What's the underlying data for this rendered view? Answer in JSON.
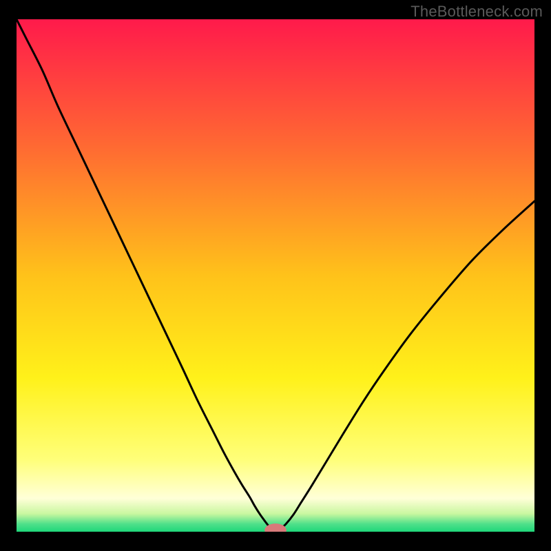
{
  "watermark": "TheBottleneck.com",
  "chart_data": {
    "type": "line",
    "title": "",
    "xlabel": "",
    "ylabel": "",
    "xlim": [
      0,
      100
    ],
    "ylim": [
      0,
      100
    ],
    "gradient_stops": [
      {
        "offset": 0.0,
        "color": "#ff1a4b"
      },
      {
        "offset": 0.25,
        "color": "#ff6a32"
      },
      {
        "offset": 0.5,
        "color": "#ffc21a"
      },
      {
        "offset": 0.7,
        "color": "#fff11a"
      },
      {
        "offset": 0.86,
        "color": "#ffff7a"
      },
      {
        "offset": 0.935,
        "color": "#ffffd8"
      },
      {
        "offset": 0.965,
        "color": "#c9f7a0"
      },
      {
        "offset": 0.985,
        "color": "#4fe08a"
      },
      {
        "offset": 1.0,
        "color": "#1fd77a"
      }
    ],
    "series": [
      {
        "name": "curve",
        "x": [
          0,
          2,
          5,
          8,
          12,
          16,
          20,
          24,
          28,
          32,
          35,
          38,
          40,
          42,
          43.5,
          45,
          46,
          47,
          48,
          48.7,
          49.3,
          49.8,
          50.3,
          51,
          52,
          53.5,
          55,
          57,
          60,
          63,
          67,
          71,
          76,
          82,
          88,
          94,
          100
        ],
        "y": [
          100,
          96,
          90,
          83,
          74.5,
          66,
          57.5,
          49,
          40.5,
          32,
          25.5,
          19.5,
          15.5,
          11.8,
          9.2,
          6.8,
          5.0,
          3.4,
          2.0,
          1.1,
          0.5,
          0.25,
          0.25,
          0.6,
          1.5,
          3.4,
          5.8,
          9.0,
          14.0,
          19.0,
          25.5,
          31.5,
          38.5,
          46.0,
          53.0,
          59.0,
          64.5
        ]
      }
    ],
    "marker": {
      "name": "target-marker",
      "x": 50,
      "y": 0.3,
      "color": "#d87a7a",
      "rx": 2.1,
      "ry": 1.3
    },
    "grid": false,
    "legend": null
  }
}
